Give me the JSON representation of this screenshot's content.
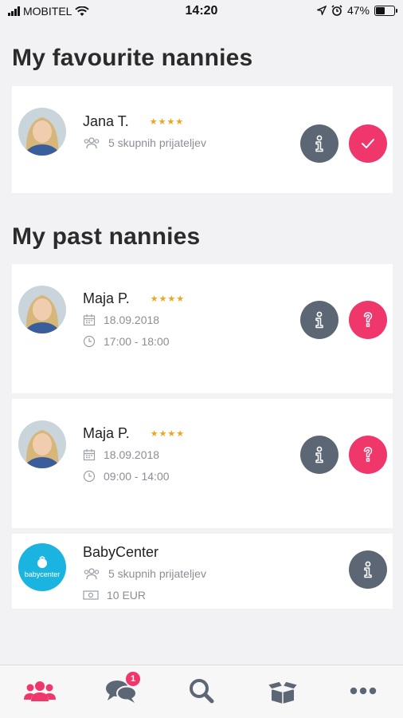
{
  "status_bar": {
    "carrier": "MOBITEL",
    "time": "14:20",
    "battery": "47%",
    "battery_level": 0.47
  },
  "favourites": {
    "title": "My favourite nannies",
    "items": [
      {
        "name": "Jana T.",
        "stars": "★★★★",
        "friends": "5 skupnih prijateljev",
        "action": "check"
      }
    ]
  },
  "past": {
    "title": "My past nannies",
    "items": [
      {
        "name": "Maja P.",
        "stars": "★★★★",
        "date": "18.09.2018",
        "time": "17:00 - 18:00",
        "action": "question"
      },
      {
        "name": "Maja P.",
        "stars": "★★★★",
        "date": "18.09.2018",
        "time": "09:00 - 14:00",
        "action": "question"
      },
      {
        "name": "BabyCenter",
        "logo_text": "babycenter",
        "friends": "5 skupnih prijateljev",
        "price": "10 EUR"
      }
    ]
  },
  "tabbar": {
    "items": [
      {
        "icon": "people-icon",
        "active": true
      },
      {
        "icon": "chat-icon",
        "badge": "1"
      },
      {
        "icon": "search-icon"
      },
      {
        "icon": "box-icon"
      },
      {
        "icon": "more-icon"
      }
    ]
  },
  "colors": {
    "accent": "#f0376b",
    "info_button": "#5d6675",
    "star": "#f0a41b"
  }
}
